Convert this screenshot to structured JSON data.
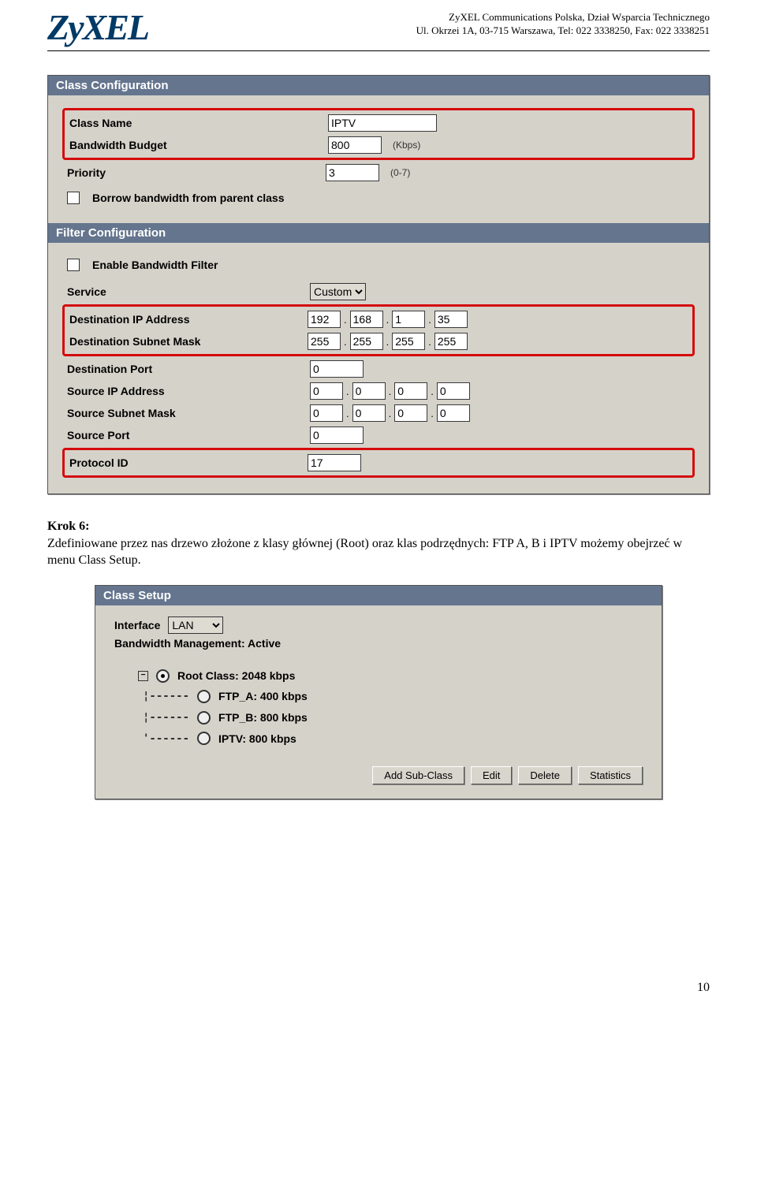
{
  "header": {
    "logo": "ZyXEL",
    "line1": "ZyXEL Communications Polska, Dział Wsparcia Technicznego",
    "line2": "Ul. Okrzei 1A, 03-715 Warszawa, Tel: 022 3338250, Fax: 022 3338251"
  },
  "panel1": {
    "title_class": "Class Configuration",
    "title_filter": "Filter Configuration",
    "rows": {
      "class_name_label": "Class Name",
      "class_name_value": "IPTV",
      "bw_budget_label": "Bandwidth Budget",
      "bw_budget_value": "800",
      "bw_budget_unit": "(Kbps)",
      "priority_label": "Priority",
      "priority_value": "3",
      "priority_range": "(0-7)",
      "borrow_label": "Borrow bandwidth from parent class",
      "enable_filter_label": "Enable Bandwidth Filter",
      "service_label": "Service",
      "service_value": "Custom",
      "dest_ip_label": "Destination IP Address",
      "dest_ip": [
        "192",
        "168",
        "1",
        "35"
      ],
      "dest_mask_label": "Destination Subnet Mask",
      "dest_mask": [
        "255",
        "255",
        "255",
        "255"
      ],
      "dest_port_label": "Destination Port",
      "dest_port_value": "0",
      "src_ip_label": "Source IP Address",
      "src_ip": [
        "0",
        "0",
        "0",
        "0"
      ],
      "src_mask_label": "Source Subnet Mask",
      "src_mask": [
        "0",
        "0",
        "0",
        "0"
      ],
      "src_port_label": "Source Port",
      "src_port_value": "0",
      "proto_label": "Protocol ID",
      "proto_value": "17"
    }
  },
  "bodytext": {
    "step_label": "Krok 6:",
    "paragraph": "Zdefiniowane przez nas drzewo złożone z klasy głównej (Root) oraz klas podrzędnych: FTP A, B i IPTV możemy obejrzeć w menu Class Setup."
  },
  "panel2": {
    "title": "Class Setup",
    "interface_label": "Interface",
    "interface_value": "LAN",
    "bwm_label": "Bandwidth Management: Active",
    "tree": {
      "root": "Root Class: 2048 kbps",
      "children": [
        "FTP_A: 400 kbps",
        "FTP_B: 800 kbps",
        "IPTV: 800 kbps"
      ]
    },
    "buttons": {
      "add": "Add Sub-Class",
      "edit": "Edit",
      "del": "Delete",
      "stats": "Statistics"
    }
  },
  "page_number": "10"
}
